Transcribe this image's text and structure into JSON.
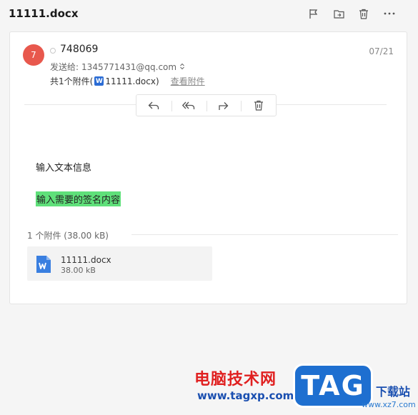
{
  "header": {
    "title": "11111.docx",
    "actions": [
      "flag-icon",
      "move-to-folder-icon",
      "delete-icon",
      "more-icon"
    ]
  },
  "message": {
    "avatar_initial": "7",
    "sender": "748069",
    "date": "07/21",
    "recipient_label": "发送给:",
    "recipient": "1345771431@qq.com",
    "attachment_summary_prefix": "共1个附件(",
    "attachment_summary_file": "11111.docx",
    "attachment_summary_suffix": ")",
    "view_attachments_label": "查看附件",
    "toolbar": [
      "reply-icon",
      "reply-all-icon",
      "forward-icon",
      "delete-icon"
    ],
    "body_text": "输入文本信息",
    "signature_text": "输入需要的签名内容",
    "highlight_color": "#5fe07a"
  },
  "attachments": {
    "count_label": "1 个附件 (38.00 kB)",
    "items": [
      {
        "name": "11111.docx",
        "size": "38.00 kB"
      }
    ]
  },
  "watermark": {
    "site_cn": "电脑技术网",
    "site_url": "www.tagxp.com",
    "badge": "TAG",
    "download_cn": "下载站",
    "download_url": "www.xz7.com"
  },
  "colors": {
    "avatar": "#e8584d",
    "word_blue": "#2b6cd4"
  }
}
